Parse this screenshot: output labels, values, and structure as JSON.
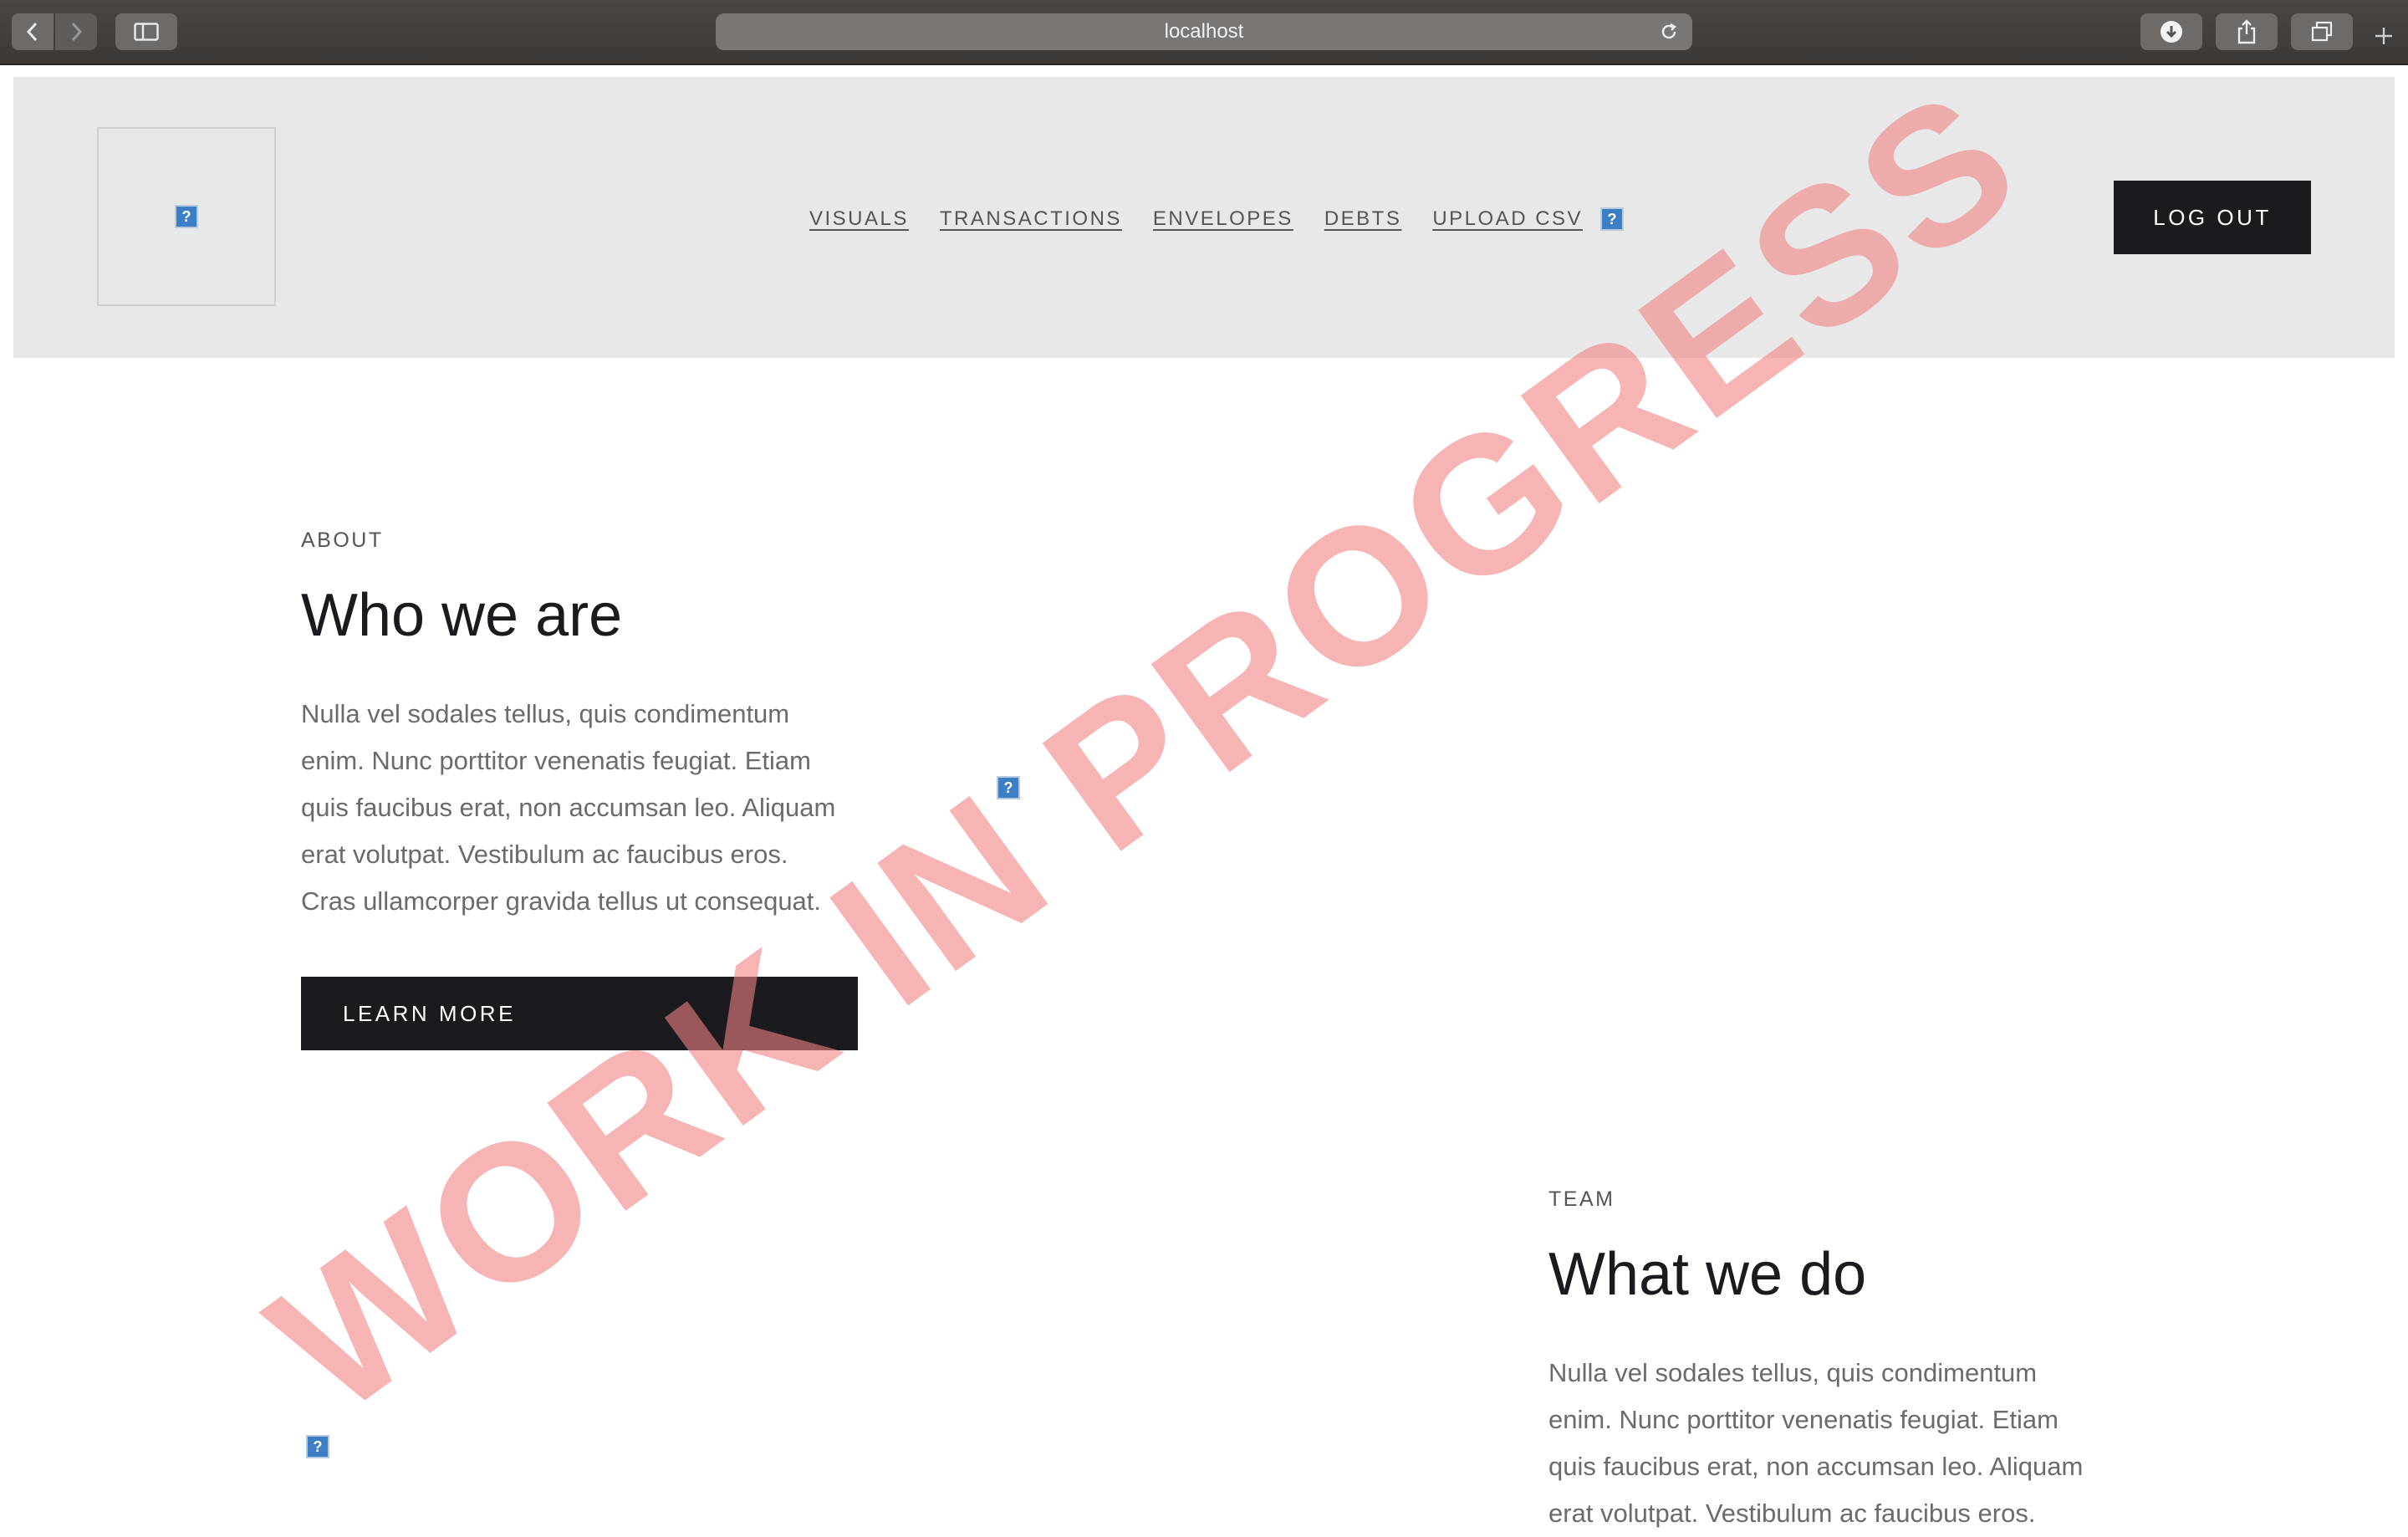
{
  "browser": {
    "url": "localhost"
  },
  "header": {
    "nav": [
      "VISUALS",
      "TRANSACTIONS",
      "ENVELOPES",
      "DEBTS",
      "UPLOAD CSV"
    ],
    "logout_label": "LOG OUT"
  },
  "about": {
    "eyebrow": "ABOUT",
    "title": "Who we are",
    "lines": [
      "Nulla vel sodales tellus, quis condimentum",
      "enim. Nunc porttitor venenatis feugiat. Etiam",
      "quis faucibus erat, non accumsan leo. Aliquam",
      "erat volutpat. Vestibulum ac faucibus eros.",
      "Cras ullamcorper gravida tellus ut consequat."
    ],
    "button_label": "LEARN MORE"
  },
  "team": {
    "eyebrow": "TEAM",
    "title": "What we do",
    "lines": [
      "Nulla vel sodales tellus, quis condimentum",
      "enim. Nunc porttitor venenatis feugiat. Etiam",
      "quis faucibus erat, non accumsan leo. Aliquam",
      "erat volutpat. Vestibulum ac faucibus eros."
    ]
  },
  "watermark": "WORK IN PROGRESS",
  "broken_image_glyph": "?",
  "colors": {
    "dark_button": "#1b1b1f",
    "header_bg": "#e8e8e8",
    "watermark": "#f08282"
  }
}
